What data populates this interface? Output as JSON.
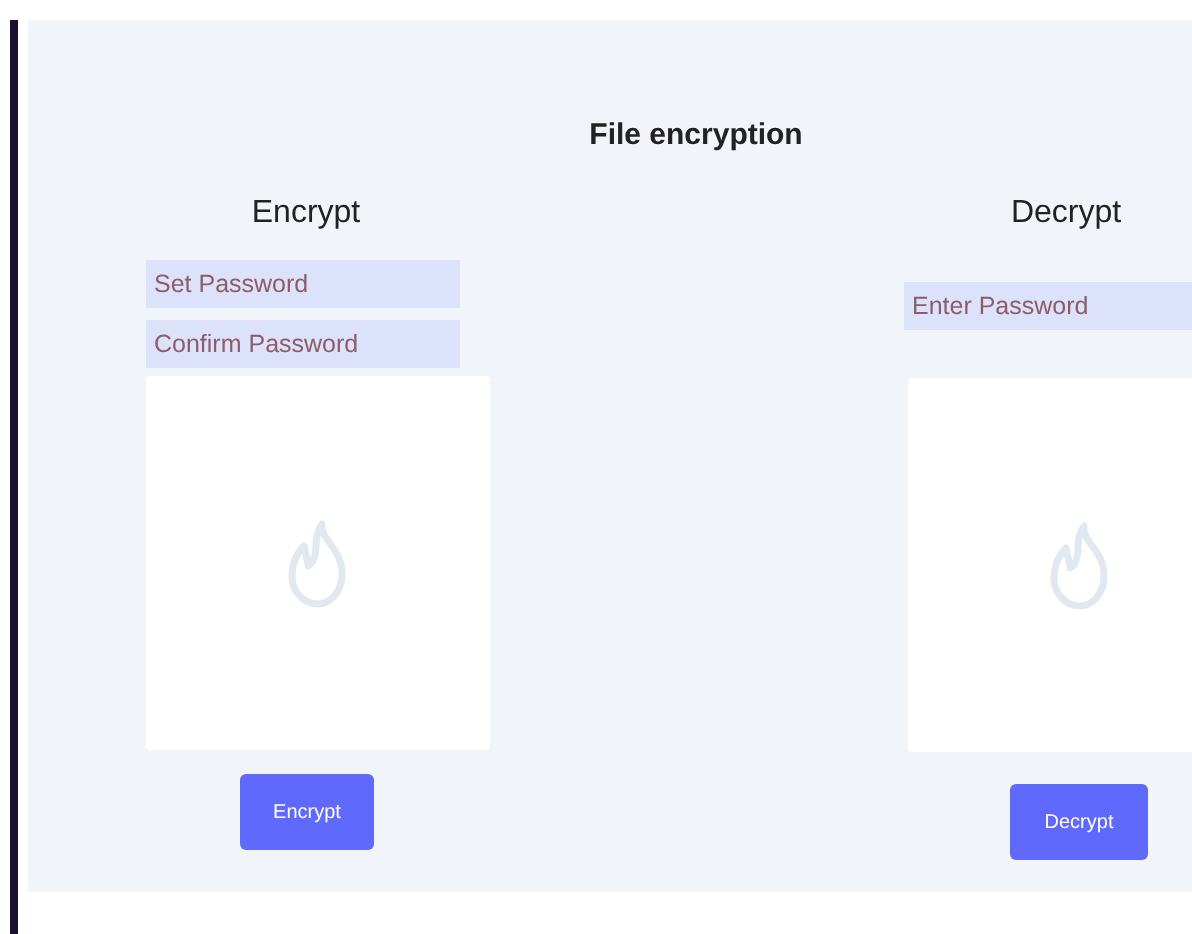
{
  "title": "File encryption",
  "sections": [
    {
      "heading": "Encrypt",
      "fields": [
        {
          "placeholder": "Set Password"
        },
        {
          "placeholder": "Confirm Password"
        }
      ],
      "button": "Encrypt"
    },
    {
      "heading": "Decrypt",
      "fields": [
        {
          "placeholder": "Enter Password"
        }
      ],
      "button": "Decrypt"
    }
  ]
}
